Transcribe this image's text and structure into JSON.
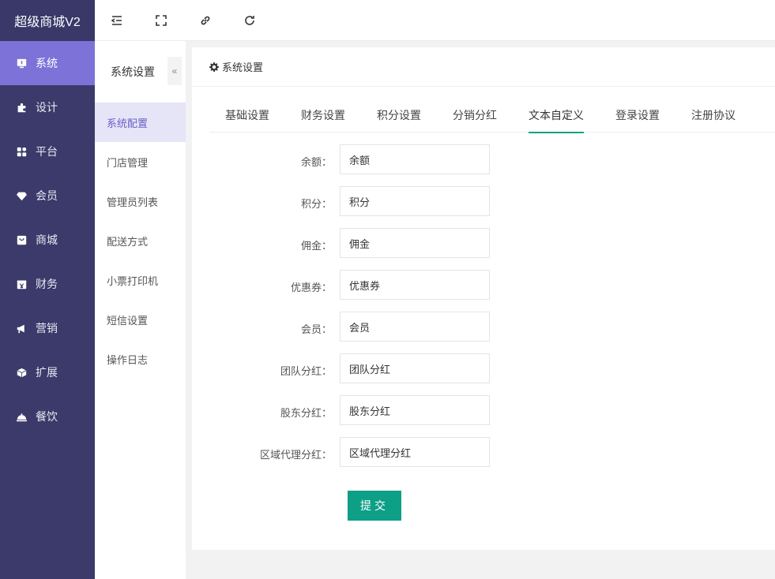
{
  "brand": "超级商城V2",
  "sidebar": {
    "items": [
      {
        "label": "系统",
        "icon": "monitor-icon"
      },
      {
        "label": "设计",
        "icon": "puzzle-icon"
      },
      {
        "label": "平台",
        "icon": "grid-icon"
      },
      {
        "label": "会员",
        "icon": "diamond-icon"
      },
      {
        "label": "商城",
        "icon": "shopping-bag-icon"
      },
      {
        "label": "财务",
        "icon": "yen-icon"
      },
      {
        "label": "营销",
        "icon": "megaphone-icon"
      },
      {
        "label": "扩展",
        "icon": "cube-icon"
      },
      {
        "label": "餐饮",
        "icon": "dish-icon"
      }
    ],
    "active_index": 0
  },
  "toolbar": {
    "icons": [
      "indent-icon",
      "fullscreen-icon",
      "link-icon",
      "refresh-icon"
    ]
  },
  "subnav": {
    "title": "系统设置",
    "collapse_glyph": "«",
    "items": [
      "系统配置",
      "门店管理",
      "管理员列表",
      "配送方式",
      "小票打印机",
      "短信设置",
      "操作日志"
    ],
    "active_index": 0
  },
  "card": {
    "title": "系统设置",
    "tabs": [
      "基础设置",
      "财务设置",
      "积分设置",
      "分销分红",
      "文本自定义",
      "登录设置",
      "注册协议"
    ],
    "active_tab": 4
  },
  "form": {
    "fields": [
      {
        "label": "余额：",
        "value": "余额"
      },
      {
        "label": "积分：",
        "value": "积分"
      },
      {
        "label": "佣金：",
        "value": "佣金"
      },
      {
        "label": "优惠券：",
        "value": "优惠券"
      },
      {
        "label": "会员：",
        "value": "会员"
      },
      {
        "label": "团队分红：",
        "value": "团队分红"
      },
      {
        "label": "股东分红：",
        "value": "股东分红"
      },
      {
        "label": "区域代理分红：",
        "value": "区域代理分红"
      }
    ],
    "submit_label": "提交"
  },
  "colors": {
    "sidebar_bg": "#3b3a6b",
    "sidebar_active": "#7d72d8",
    "accent": "#0e9f87",
    "subnav_active_bg": "#e6e4f7",
    "subnav_active_text": "#6a5fc8"
  }
}
